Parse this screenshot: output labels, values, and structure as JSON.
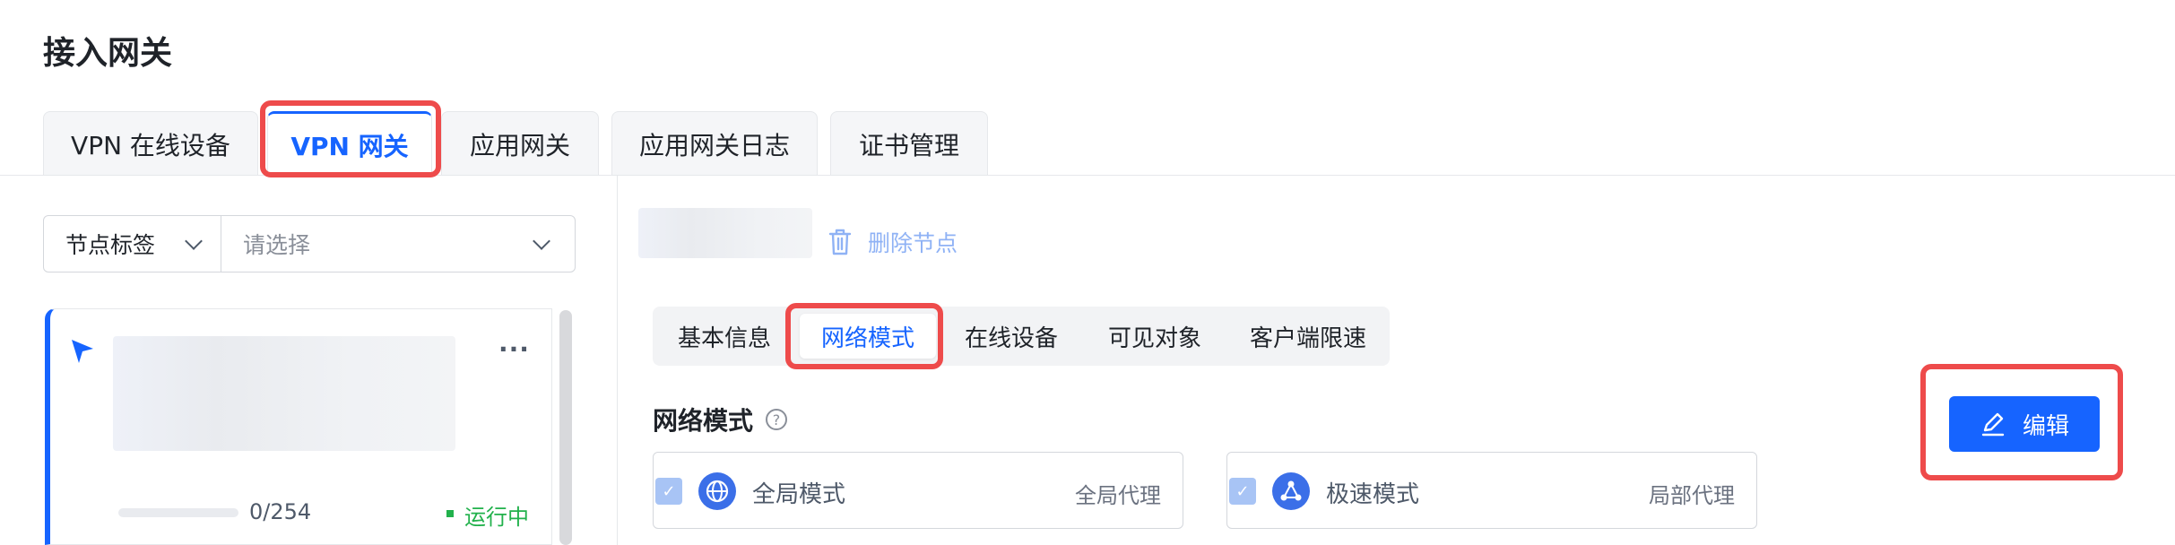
{
  "page": {
    "title": "接入网关"
  },
  "top_tabs": [
    {
      "label": "VPN 在线设备"
    },
    {
      "label": "VPN 网关",
      "active": true
    },
    {
      "label": "应用网关"
    },
    {
      "label": "应用网关日志"
    },
    {
      "label": "证书管理"
    }
  ],
  "filter": {
    "tag_label": "节点标签",
    "placeholder": "请选择"
  },
  "node": {
    "count": "0/254",
    "status": "运行中",
    "status_color": "#22b14c",
    "more": "···"
  },
  "detail": {
    "delete_label": "删除节点",
    "tabs": [
      {
        "label": "基本信息"
      },
      {
        "label": "网络模式",
        "active": true
      },
      {
        "label": "在线设备"
      },
      {
        "label": "可见对象"
      },
      {
        "label": "客户端限速"
      }
    ],
    "section_title": "网络模式",
    "help": "?",
    "modes": [
      {
        "label": "全局模式",
        "tag": "全局代理",
        "icon": "globe-icon"
      },
      {
        "label": "极速模式",
        "tag": "局部代理",
        "icon": "share-nodes-icon"
      }
    ],
    "edit_label": "编辑"
  },
  "colors": {
    "primary": "#1664ff",
    "highlight": "#ee4b4b"
  }
}
